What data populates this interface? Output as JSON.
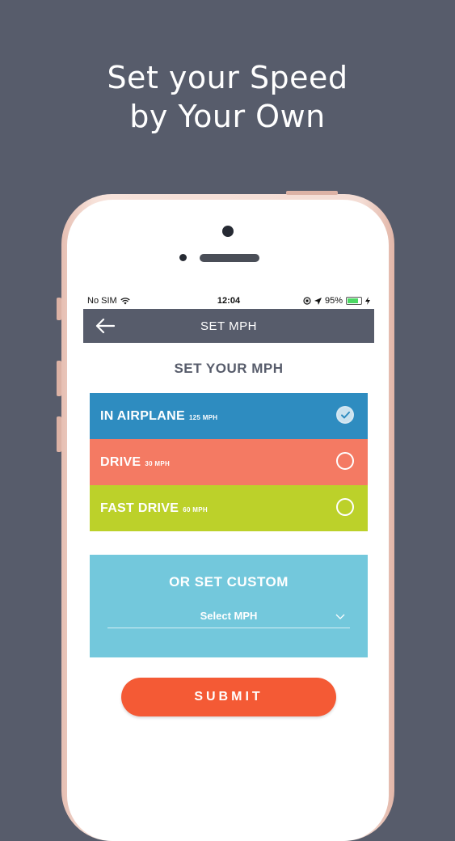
{
  "headline": {
    "line1": "Set your Speed",
    "line2": "by Your Own"
  },
  "statusbar": {
    "carrier": "No SIM",
    "time": "12:04",
    "battery": "95%",
    "battery_level": 0.95
  },
  "navbar": {
    "title": "SET MPH"
  },
  "section_title": "SET YOUR MPH",
  "options": [
    {
      "label": "IN AIRPLANE",
      "speed": "125 MPH",
      "color": "#2e8cc0",
      "selected": true
    },
    {
      "label": "DRIVE",
      "speed": "30 MPH",
      "color": "#f47a63",
      "selected": false
    },
    {
      "label": "FAST DRIVE",
      "speed": "60 MPH",
      "color": "#bcd12a",
      "selected": false
    }
  ],
  "custom": {
    "title": "OR SET CUSTOM",
    "select_value": "Select MPH"
  },
  "submit_label": "SUBMIT",
  "colors": {
    "background": "#575c6b",
    "navbar": "#575c6b",
    "custom": "#73c8dc",
    "submit": "#f45a35"
  },
  "icons": {
    "back": "arrow-left-icon",
    "wifi": "wifi-icon",
    "location": "location-arrow-icon",
    "check": "check-icon",
    "chevron": "chevron-down-icon"
  }
}
